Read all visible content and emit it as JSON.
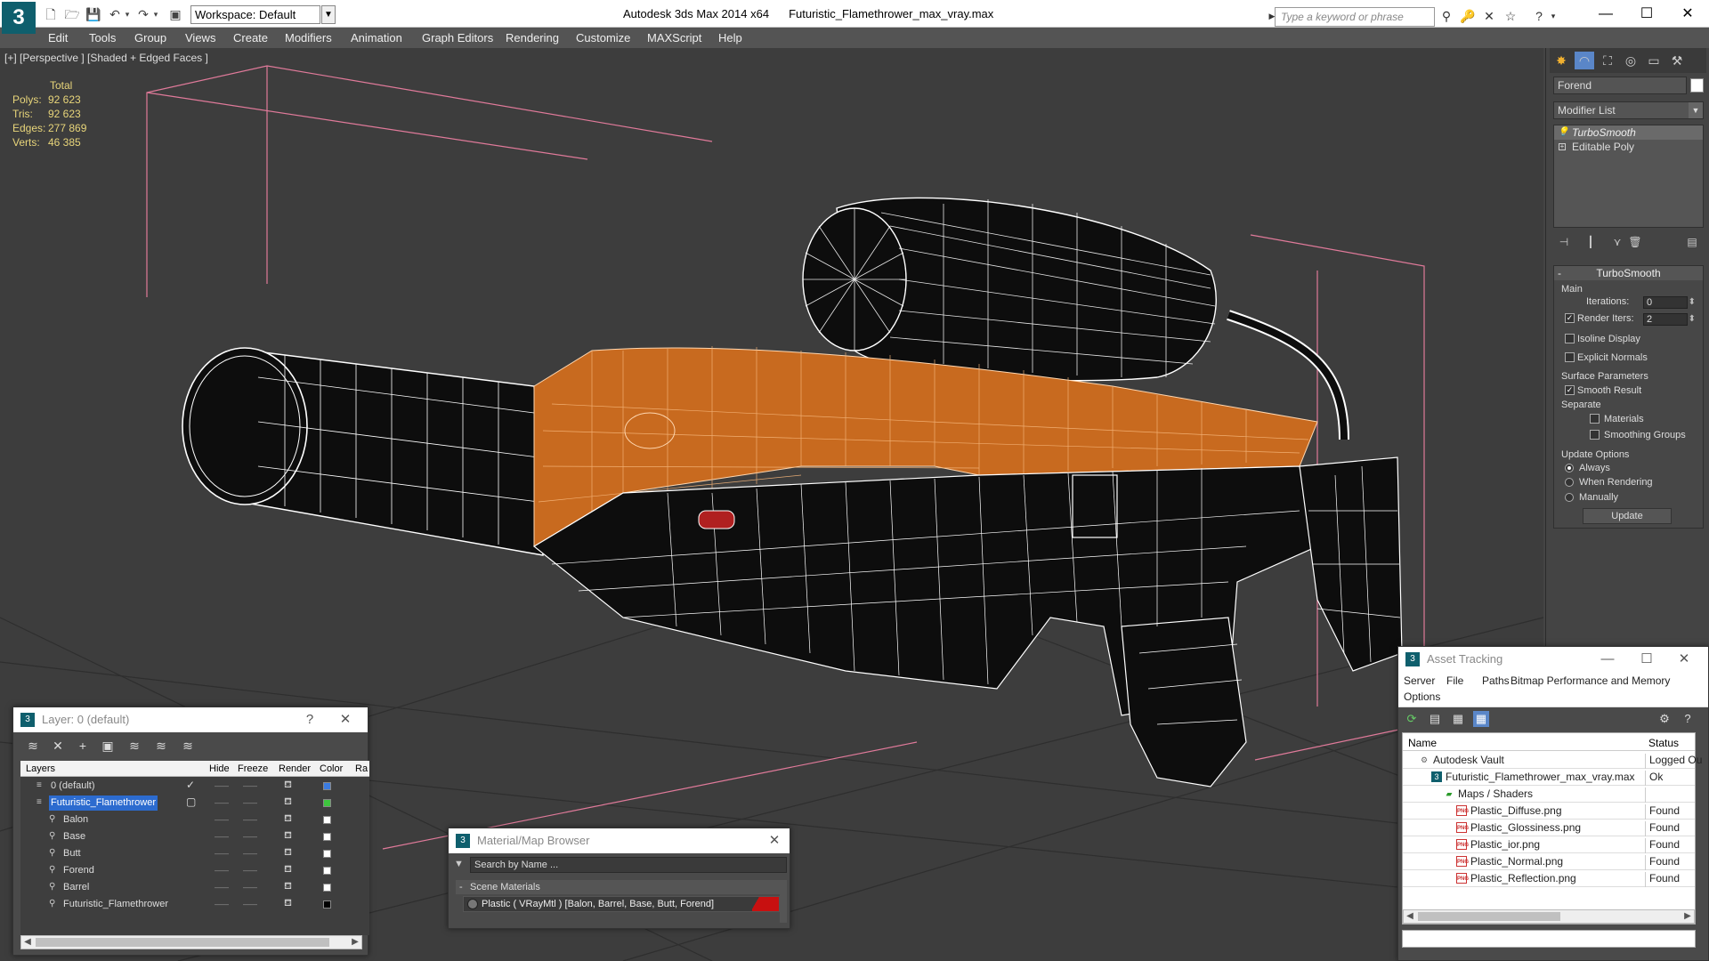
{
  "app": {
    "title": "Autodesk 3ds Max  2014 x64",
    "file": "Futuristic_Flamethrower_max_vray.max",
    "logo_letter": "3",
    "workspace": "Workspace: Default",
    "search_placeholder": "Type a keyword or phrase"
  },
  "menu": [
    "Edit",
    "Tools",
    "Group",
    "Views",
    "Create",
    "Modifiers",
    "Animation",
    "Graph Editors",
    "Rendering",
    "Customize",
    "MAXScript",
    "Help"
  ],
  "viewport": {
    "label": "[+] [Perspective ] [Shaded + Edged Faces ]",
    "stats": {
      "header": "Total",
      "rows": [
        {
          "k": "Polys:",
          "v": "92 623"
        },
        {
          "k": "Tris:",
          "v": "92 623"
        },
        {
          "k": "Edges:",
          "v": "277 869"
        },
        {
          "k": "Verts:",
          "v": "46 385"
        }
      ]
    },
    "colors": {
      "bg": "#3d3d3d",
      "orange": "#c86a1f",
      "wire": "#ffffff",
      "grid": "#2b2b2b",
      "bbox": "#e07a9a"
    }
  },
  "command_panel": {
    "object_name": "Forend",
    "modifier_list": "Modifier List",
    "stack": [
      {
        "label": "TurboSmooth",
        "selected": true
      },
      {
        "label": "Editable Poly",
        "selected": false
      }
    ],
    "turbosmooth": {
      "title": "TurboSmooth",
      "main": "Main",
      "iterations_label": "Iterations:",
      "iterations": "0",
      "render_iters_label": "Render Iters:",
      "render_iters": "2",
      "isoline": "Isoline Display",
      "explicit": "Explicit Normals",
      "surface": "Surface Parameters",
      "smooth_result": "Smooth Result",
      "separate": "Separate",
      "materials": "Materials",
      "smoothing_groups": "Smoothing Groups",
      "update_options": "Update Options",
      "always": "Always",
      "when_rendering": "When Rendering",
      "manually": "Manually",
      "update_btn": "Update"
    }
  },
  "layer_window": {
    "title": "Layer: 0 (default)",
    "columns": [
      "Layers",
      "Hide",
      "Freeze",
      "Render",
      "Color",
      "Ra"
    ],
    "rows": [
      {
        "name": "0 (default)",
        "level": 0,
        "color": "#3b7be0",
        "check": true,
        "selected": false
      },
      {
        "name": "Futuristic_Flamethrower",
        "level": 0,
        "color": "#3ec43e",
        "check": false,
        "selected": true
      },
      {
        "name": "Balon",
        "level": 1,
        "color": "#ffffff"
      },
      {
        "name": "Base",
        "level": 1,
        "color": "#ffffff"
      },
      {
        "name": "Butt",
        "level": 1,
        "color": "#ffffff"
      },
      {
        "name": "Forend",
        "level": 1,
        "color": "#ffffff"
      },
      {
        "name": "Barrel",
        "level": 1,
        "color": "#ffffff"
      },
      {
        "name": "Futuristic_Flamethrower",
        "level": 1,
        "color": "#000000"
      }
    ]
  },
  "material_browser": {
    "title": "Material/Map Browser",
    "search": "Search by Name ...",
    "section": "Scene Materials",
    "item": "Plastic  ( VRayMtl )  [Balon, Barrel, Base, Butt, Forend]"
  },
  "asset_tracking": {
    "title": "Asset Tracking",
    "menu": [
      "Server",
      "File",
      "Paths",
      "Bitmap Performance and Memory",
      "Options"
    ],
    "columns": [
      "Name",
      "Status"
    ],
    "rows": [
      {
        "name": "Autodesk Vault",
        "status": "Logged Ou",
        "indent": 1,
        "icon": "vault"
      },
      {
        "name": "Futuristic_Flamethrower_max_vray.max",
        "status": "Ok",
        "indent": 2,
        "icon": "max"
      },
      {
        "name": "Maps / Shaders",
        "status": "",
        "indent": 3,
        "icon": "maps"
      },
      {
        "name": "Plastic_Diffuse.png",
        "status": "Found",
        "indent": 4,
        "icon": "png"
      },
      {
        "name": "Plastic_Glossiness.png",
        "status": "Found",
        "indent": 4,
        "icon": "png"
      },
      {
        "name": "Plastic_ior.png",
        "status": "Found",
        "indent": 4,
        "icon": "png"
      },
      {
        "name": "Plastic_Normal.png",
        "status": "Found",
        "indent": 4,
        "icon": "png"
      },
      {
        "name": "Plastic_Reflection.png",
        "status": "Found",
        "indent": 4,
        "icon": "png"
      }
    ]
  },
  "icons": {
    "png_badge": "PNG"
  }
}
